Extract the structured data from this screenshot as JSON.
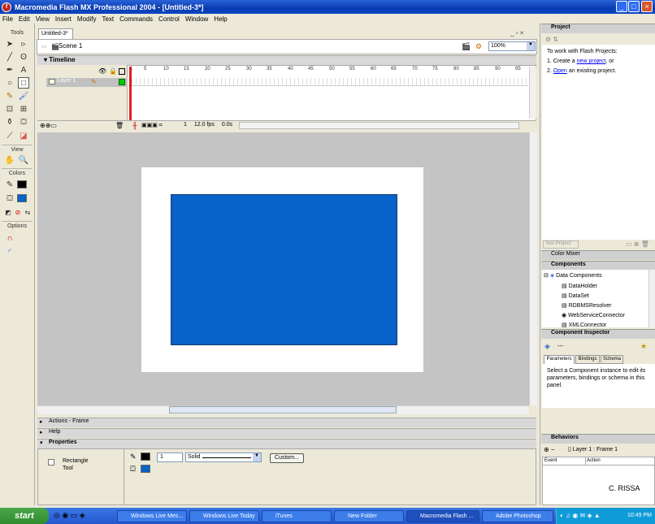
{
  "window": {
    "title": "Macromedia Flash MX Professional 2004 - [Untitled-3*]"
  },
  "menu": [
    "File",
    "Edit",
    "View",
    "Insert",
    "Modify",
    "Text",
    "Commands",
    "Control",
    "Window",
    "Help"
  ],
  "tools": {
    "header": "Tools",
    "view": "View",
    "colors": "Colors",
    "options": "Options"
  },
  "document": {
    "tab": "Untitled-3*",
    "scene": "Scene 1",
    "zoom": "100%"
  },
  "timeline": {
    "header": "Timeline",
    "layer": "Layer 1",
    "ruler": [
      "1",
      "5",
      "10",
      "15",
      "20",
      "25",
      "30",
      "35",
      "40",
      "45",
      "50",
      "55",
      "60",
      "65",
      "70",
      "75",
      "80",
      "85",
      "90",
      "95"
    ],
    "frame": "1",
    "fps": "12.0 fps",
    "time": "0.0s"
  },
  "panels": {
    "actions": "Actions - Frame",
    "help": "Help",
    "properties": "Properties"
  },
  "properties": {
    "tool_line1": "Rectangle",
    "tool_line2": "Tool",
    "stroke_height": "1",
    "stroke_style": "Solid",
    "custom_label": "Custom..."
  },
  "project": {
    "header": "Project",
    "intro": "To work with Flash Projects:",
    "step1_pre": "1. Create a ",
    "step1_link": "new project",
    "step1_post": ", or",
    "step2_pre": "2. ",
    "step2_link": "Open",
    "step2_post": " an existing project.",
    "test_button": "Test Project"
  },
  "color_mixer": {
    "header": "Color Mixer"
  },
  "components": {
    "header": "Components",
    "group": "Data Components",
    "items": [
      "DataHolder",
      "DataSet",
      "RDBMSResolver",
      "WebServiceConnector",
      "XMLConnector"
    ]
  },
  "inspector": {
    "header": "Component Inspector",
    "value": "---",
    "tabs": [
      "Parameters",
      "Bindings",
      "Schema"
    ],
    "message": "Select a Component instance to edit its parameters, bindings or schema in this panel."
  },
  "behaviors": {
    "header": "Behaviors",
    "target": "Layer 1 : Frame 1",
    "col_event": "Event",
    "col_action": "Action"
  },
  "signature": "C. RISSA",
  "taskbar": {
    "start": "start",
    "tasks": [
      "Windows Live Mes...",
      "Windows Live Today",
      "iTunes",
      "New Folder",
      "Macromedia Flash ...",
      "Adobe Photoshop"
    ],
    "clock": "10:49 PM"
  },
  "colors": {
    "fill": "#0763c8",
    "stroke": "#000000",
    "titlebar": "#0a3bb0",
    "pasteboard": "#c4c4c4"
  }
}
